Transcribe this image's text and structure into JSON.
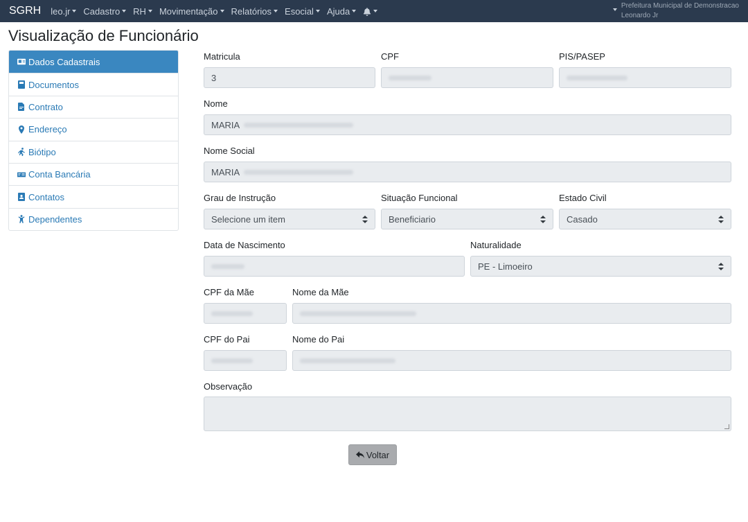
{
  "navbar": {
    "brand": "SGRH",
    "menus": [
      {
        "label": "leo.jr"
      },
      {
        "label": "Cadastro"
      },
      {
        "label": "RH"
      },
      {
        "label": "Movimentação"
      },
      {
        "label": "Relatórios"
      },
      {
        "label": "Esocial"
      },
      {
        "label": "Ajuda"
      }
    ],
    "notification_icon": "bell-icon",
    "org_name": "Prefeitura Municipal de Demonstracao",
    "user_name": "Leonardo Jr"
  },
  "page": {
    "title": "Visualização de Funcionário"
  },
  "sidebar": {
    "items": [
      {
        "label": "Dados Cadastrais",
        "icon": "id-card-icon",
        "active": true
      },
      {
        "label": "Documentos",
        "icon": "book-icon"
      },
      {
        "label": "Contrato",
        "icon": "file-contract-icon"
      },
      {
        "label": "Endereço",
        "icon": "map-marker-icon"
      },
      {
        "label": "Biótipo",
        "icon": "running-person-icon"
      },
      {
        "label": "Conta Bancária",
        "icon": "money-check-icon"
      },
      {
        "label": "Contatos",
        "icon": "address-book-icon"
      },
      {
        "label": "Dependentes",
        "icon": "child-icon"
      }
    ]
  },
  "form": {
    "matricula": {
      "label": "Matricula",
      "value": "3"
    },
    "cpf": {
      "label": "CPF",
      "value": ""
    },
    "pis": {
      "label": "PIS/PASEP",
      "value": ""
    },
    "nome": {
      "label": "Nome",
      "value": "MARIA"
    },
    "nome_social": {
      "label": "Nome Social",
      "value": "MARIA"
    },
    "grau_instrucao": {
      "label": "Grau de Instrução",
      "value": "Selecione um item"
    },
    "situacao_funcional": {
      "label": "Situação Funcional",
      "value": "Beneficiario"
    },
    "estado_civil": {
      "label": "Estado Civil",
      "value": "Casado"
    },
    "data_nascimento": {
      "label": "Data de Nascimento",
      "value": ""
    },
    "naturalidade": {
      "label": "Naturalidade",
      "value": "PE - Limoeiro"
    },
    "cpf_mae": {
      "label": "CPF da Mãe",
      "value": ""
    },
    "nome_mae": {
      "label": "Nome da Mãe",
      "value": ""
    },
    "cpf_pai": {
      "label": "CPF do Pai",
      "value": ""
    },
    "nome_pai": {
      "label": "Nome do Pai",
      "value": ""
    },
    "observacao": {
      "label": "Observação",
      "value": ""
    }
  },
  "actions": {
    "back_label": "Voltar",
    "back_icon": "reply-icon"
  }
}
